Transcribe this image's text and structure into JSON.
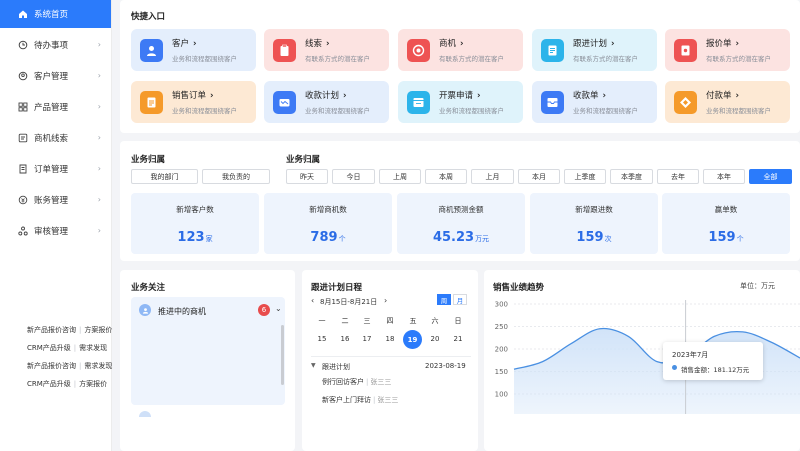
{
  "sidebar": {
    "items": [
      {
        "label": "系统首页",
        "icon": "home-icon",
        "active": true
      },
      {
        "label": "待办事项",
        "icon": "clock-icon"
      },
      {
        "label": "客户管理",
        "icon": "user-icon"
      },
      {
        "label": "产品管理",
        "icon": "grid-icon"
      },
      {
        "label": "商机线索",
        "icon": "clue-icon"
      },
      {
        "label": "订单管理",
        "icon": "order-icon"
      },
      {
        "label": "账务管理",
        "icon": "account-icon"
      },
      {
        "label": "审核管理",
        "icon": "audit-icon"
      }
    ]
  },
  "quick": {
    "title": "快捷入口",
    "cards": [
      {
        "title": "客户",
        "sub": "业务和流程都围绕客户"
      },
      {
        "title": "线索",
        "sub": "有联系方式的潜在客户"
      },
      {
        "title": "商机",
        "sub": "有联系方式的潜在客户"
      },
      {
        "title": "跟进计划",
        "sub": "有联系方式的潜在客户"
      },
      {
        "title": "报价单",
        "sub": "有联系方式的潜在客户"
      },
      {
        "title": "销售订单",
        "sub": "业务和流程都围绕客户"
      },
      {
        "title": "收款计划",
        "sub": "业务和流程都围绕客户"
      },
      {
        "title": "开票申请",
        "sub": "业务和流程都围绕客户"
      },
      {
        "title": "收款单",
        "sub": "业务和流程都围绕客户"
      },
      {
        "title": "付款单",
        "sub": "业务和流程都围绕客户"
      }
    ]
  },
  "business": {
    "owner_title": "业务归属",
    "owner_options": [
      "我的部门",
      "我负责的"
    ],
    "period_title": "业务归属",
    "period_options": [
      "昨天",
      "今日",
      "上周",
      "本周",
      "上月",
      "本月",
      "上季度",
      "本季度",
      "去年",
      "本年",
      "全部"
    ],
    "stats": [
      {
        "label": "新增客户数",
        "value": "123",
        "unit": "家"
      },
      {
        "label": "新增商机数",
        "value": "789",
        "unit": "个"
      },
      {
        "label": "商机预测金额",
        "value": "45.23",
        "unit": "万元"
      },
      {
        "label": "新增跟进数",
        "value": "159",
        "unit": "次"
      },
      {
        "label": "赢单数",
        "value": "159",
        "unit": "个"
      }
    ]
  },
  "focus": {
    "title": "业务关注",
    "group_label": "推进中的商机",
    "badge": "6",
    "items": [
      [
        "新产品报价咨询",
        "方案报价"
      ],
      [
        "CRM产品升级",
        "需求发现"
      ],
      [
        "新产品报价咨询",
        "需求发现"
      ],
      [
        "CRM产品升级",
        "方案报价"
      ]
    ]
  },
  "schedule": {
    "title": "跟进计划日程",
    "range": "8月15日-8月21日",
    "view_week": "周",
    "view_month": "月",
    "weekdays": [
      "一",
      "二",
      "三",
      "四",
      "五",
      "六",
      "日"
    ],
    "days": [
      "15",
      "16",
      "17",
      "18",
      "19",
      "20",
      "21"
    ],
    "today": "19",
    "plan_label": "跟进计划",
    "plan_date": "2023-08-19",
    "plans": [
      {
        "title": "例行回访客户",
        "person": "张三三"
      },
      {
        "title": "新客户上门拜访",
        "person": "张三三"
      }
    ]
  },
  "trend": {
    "title": "销售业绩趋势",
    "unit": "单位：万元",
    "tooltip_title": "2023年7月",
    "tooltip_text": "销售金额：181.12万元"
  },
  "chart_data": {
    "type": "area",
    "title": "销售业绩趋势",
    "ylabel": "单位：万元",
    "ylim": [
      100,
      300
    ],
    "yticks": [
      300,
      250,
      200,
      150,
      100
    ],
    "x": [
      0,
      1,
      2,
      3,
      4,
      5,
      6,
      7,
      8,
      9,
      10
    ],
    "series": [
      {
        "name": "销售金额",
        "values": [
          155,
          172,
          212,
          245,
          228,
          172,
          182,
          228,
          238,
          215,
          180
        ]
      }
    ],
    "highlight_index": 6,
    "colors": {
      "line": "#4a90e2",
      "fill": "#cfe2f8"
    }
  }
}
